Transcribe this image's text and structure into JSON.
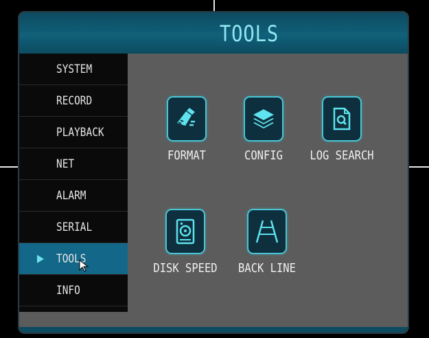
{
  "header": {
    "title": "TOOLS"
  },
  "sidebar": {
    "items": [
      {
        "label": "SYSTEM",
        "active": false
      },
      {
        "label": "RECORD",
        "active": false
      },
      {
        "label": "PLAYBACK",
        "active": false
      },
      {
        "label": "NET",
        "active": false
      },
      {
        "label": "ALARM",
        "active": false
      },
      {
        "label": "SERIAL",
        "active": false
      },
      {
        "label": "TOOLS",
        "active": true
      },
      {
        "label": "INFO",
        "active": false
      }
    ]
  },
  "tools": [
    {
      "label": "FORMAT",
      "icon": "format-brush-icon"
    },
    {
      "label": "CONFIG",
      "icon": "layers-icon"
    },
    {
      "label": "LOG SEARCH",
      "icon": "document-search-icon"
    },
    {
      "label": "DISK SPEED",
      "icon": "disk-drive-icon"
    },
    {
      "label": "BACK LINE",
      "icon": "parking-lines-icon"
    }
  ],
  "colors": {
    "accent": "#49c6d6",
    "active_menu": "#136789",
    "title_text": "#8fe6f0",
    "panel_bg": "#5c5c5c"
  }
}
